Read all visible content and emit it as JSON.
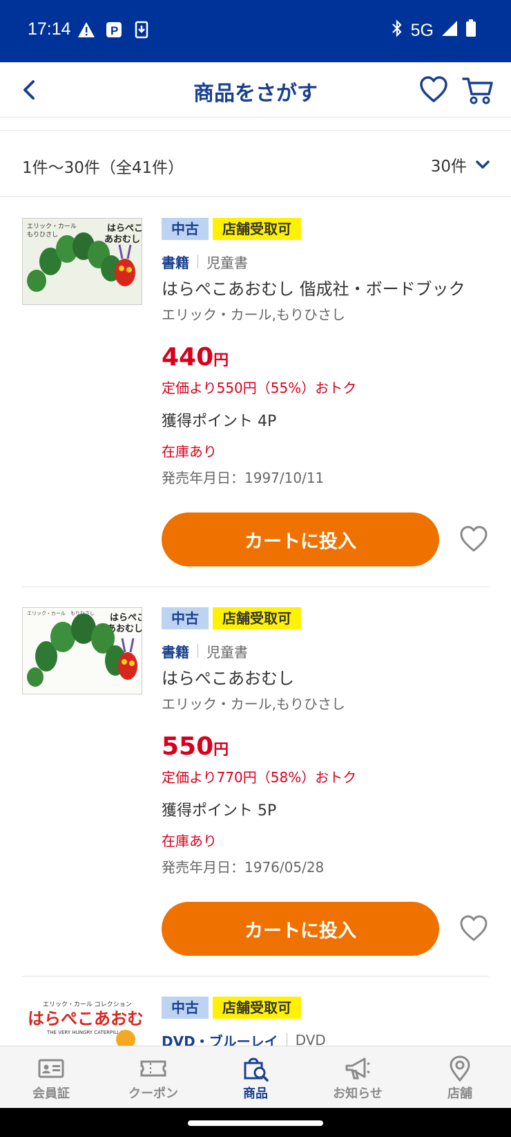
{
  "status_bar": {
    "time": "17:14",
    "network": "5G"
  },
  "header": {
    "title": "商品をさがす"
  },
  "results": {
    "count_text": "1件〜30件（全41件）",
    "per_page": "30件"
  },
  "items": [
    {
      "badge_condition": "中古",
      "badge_pickup": "店舗受取可",
      "category": "書籍",
      "subcategory": "児童書",
      "name": "はらぺこあおむし 偕成社・ボードブック",
      "author": "エリック・カール,もりひさし",
      "price": "440",
      "yen": "円",
      "discount": "定価より550円（55%）おトク",
      "points": "獲得ポイント 4P",
      "stock": "在庫あり",
      "release": "発売年月日：1997/10/11",
      "cart_label": "カートに投入",
      "cover_title": "はらぺこ あおむし"
    },
    {
      "badge_condition": "中古",
      "badge_pickup": "店舗受取可",
      "category": "書籍",
      "subcategory": "児童書",
      "name": "はらぺこあおむし",
      "author": "エリック・カール,もりひさし",
      "price": "550",
      "yen": "円",
      "discount": "定価より770円（58%）おトク",
      "points": "獲得ポイント 5P",
      "stock": "在庫あり",
      "release": "発売年月日：1976/05/28",
      "cart_label": "カートに投入",
      "cover_title": "はらぺこ あおむし"
    },
    {
      "badge_condition": "中古",
      "badge_pickup": "店舗受取可",
      "category": "DVD・ブルーレイ",
      "subcategory": "DVD",
      "cover_title": "はらぺこあおむし"
    }
  ],
  "tabs": [
    {
      "label": "会員証",
      "icon": "member-card-icon"
    },
    {
      "label": "クーポン",
      "icon": "coupon-icon"
    },
    {
      "label": "商品",
      "icon": "shopping-bag-search-icon",
      "active": true
    },
    {
      "label": "お知らせ",
      "icon": "megaphone-icon"
    },
    {
      "label": "店舗",
      "icon": "location-pin-icon"
    }
  ],
  "colors": {
    "brand": "#003399",
    "accent": "#ef7100",
    "price": "#d9001b",
    "badge_used": "#bcd3f2",
    "badge_store": "#fff200"
  }
}
